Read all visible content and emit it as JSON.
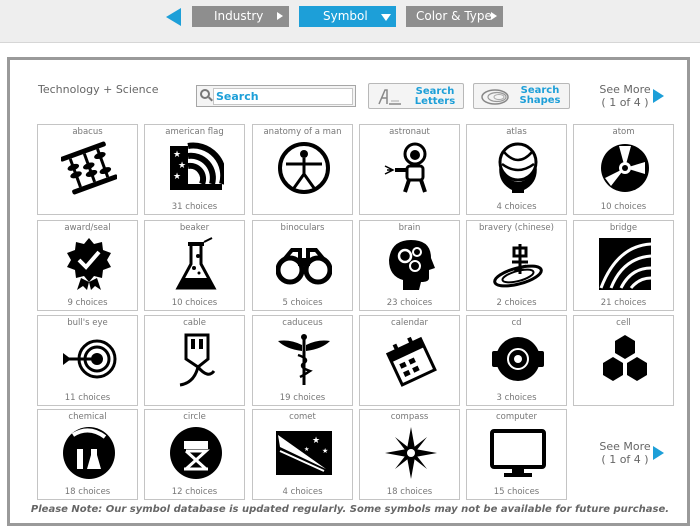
{
  "nav": {
    "tabs": [
      {
        "label": "Industry"
      },
      {
        "label": "Symbol"
      },
      {
        "label": "Color & Type"
      }
    ]
  },
  "panel": {
    "category": "Technology + Science",
    "search": {
      "placeholder": "Search"
    },
    "search_letters": "Search Letters",
    "search_shapes": "Search Shapes",
    "see_more": "See More",
    "page_indicator": "( 1 of 4 )"
  },
  "symbols": [
    {
      "name": "abacus",
      "choices": ""
    },
    {
      "name": "american flag",
      "choices": "31 choices"
    },
    {
      "name": "anatomy of a man",
      "choices": ""
    },
    {
      "name": "astronaut",
      "choices": ""
    },
    {
      "name": "atlas",
      "choices": "4 choices"
    },
    {
      "name": "atom",
      "choices": "10 choices"
    },
    {
      "name": "award/seal",
      "choices": "9 choices"
    },
    {
      "name": "beaker",
      "choices": "10 choices"
    },
    {
      "name": "binoculars",
      "choices": "5 choices"
    },
    {
      "name": "brain",
      "choices": "23 choices"
    },
    {
      "name": "bravery (chinese)",
      "choices": "2 choices"
    },
    {
      "name": "bridge",
      "choices": "21 choices"
    },
    {
      "name": "bull's eye",
      "choices": "11 choices"
    },
    {
      "name": "cable",
      "choices": ""
    },
    {
      "name": "caduceus",
      "choices": "19 choices"
    },
    {
      "name": "calendar",
      "choices": ""
    },
    {
      "name": "cd",
      "choices": "3 choices"
    },
    {
      "name": "cell",
      "choices": ""
    },
    {
      "name": "chemical",
      "choices": "18 choices"
    },
    {
      "name": "circle",
      "choices": "12 choices"
    },
    {
      "name": "comet",
      "choices": "4 choices"
    },
    {
      "name": "compass",
      "choices": "18 choices"
    },
    {
      "name": "computer",
      "choices": "15 choices"
    }
  ],
  "note": "Please Note: Our symbol database is updated regularly. Some symbols may not be available for future purchase.",
  "colors": {
    "accent": "#1d9fd8",
    "tab_grey": "#8e8e8e",
    "border": "#9a9a9a"
  }
}
